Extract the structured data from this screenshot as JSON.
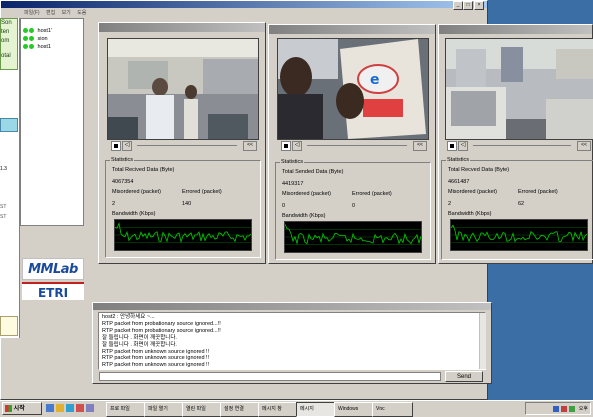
{
  "main_window": {
    "title": "",
    "menu": [
      "파일(F)",
      "편집",
      "보기",
      "도움"
    ]
  },
  "left_panel": {
    "hosts": [
      "host1'",
      "sion",
      "host1"
    ],
    "partial_labels": [
      "Son",
      "ten",
      "om",
      "otal"
    ],
    "edge_labels": [
      "1.3",
      "ST",
      "ST"
    ],
    "logos": [
      "MMLab",
      "ETRI"
    ]
  },
  "video_windows": [
    {
      "title": "",
      "stats_title": "Statistics",
      "data_label": "Total Recived Data (Byte)",
      "data_value": "4067354",
      "misordered_label": "Misordered (packet)",
      "misordered_value": "2",
      "errored_label": "Errored (packet)",
      "errored_value": "140",
      "bandwidth_label": "Bandwidth (Kbps)"
    },
    {
      "title": "",
      "stats_title": "Statistics",
      "data_label": "Total Sended Data (Byte)",
      "data_value": "4419317",
      "misordered_label": "Misordered (packet)",
      "misordered_value": "0",
      "errored_label": "Errored (packet)",
      "errored_value": "0",
      "bandwidth_label": "Bandwidth (Kbps)"
    },
    {
      "title": "",
      "stats_title": "Statistics",
      "data_label": "Total Recved Data (Byte)",
      "data_value": "4661487",
      "misordered_label": "Misordered (packet)",
      "misordered_value": "2",
      "errored_label": "Errored (packet)",
      "errored_value": "62",
      "bandwidth_label": "Bandwidth (Kbps)"
    }
  ],
  "log_window": {
    "title": "",
    "lines": [
      "host2 : 안녕하세요 ~...",
      "RTP packet from probationary source ignored...!!",
      "RTP packet from probationary source ignored...!!",
      "잘 들립니다 . 화면이 깨끗합니다.",
      "잘 들립니다 . 화면이 깨끗합니다.",
      "RTP packet from unknown source ignored !!",
      "RTP packet from unknown source ignored !!",
      "RTP packet from unknown source ignored !!"
    ],
    "send_label": "Send",
    "input_value": ""
  },
  "taskbar": {
    "start_label": "시작",
    "buttons": [
      "프로 파일",
      "파일 열기",
      "열린 파일",
      "설정 연결",
      "메시지 창",
      "메시지",
      "Windows",
      "Vnc"
    ],
    "tray_time": "오후"
  },
  "colors": {
    "desktop": "#3a6ea5",
    "graph_line": "#00d000",
    "graph_grid": "#006000",
    "active_title": "#0a246a"
  }
}
